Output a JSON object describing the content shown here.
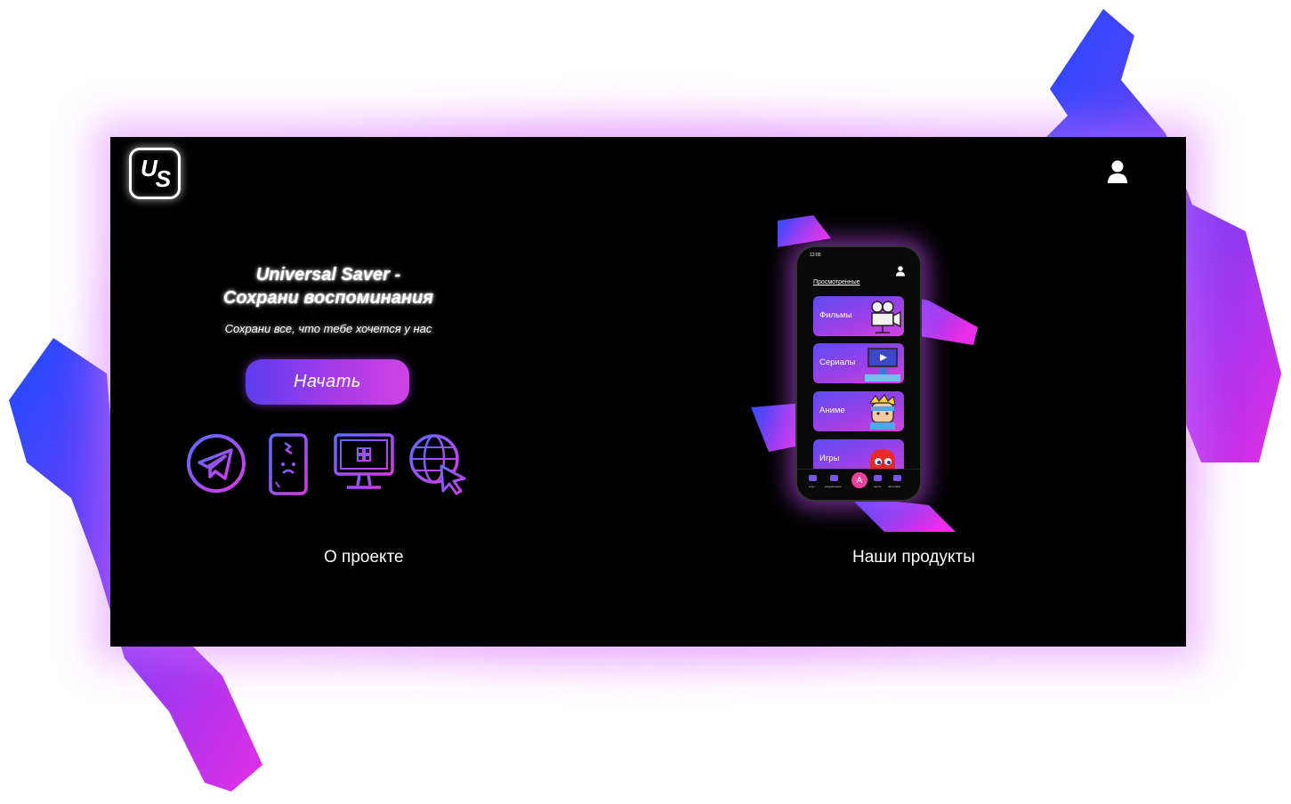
{
  "brand": {
    "logo_text_u": "U",
    "logo_text_s": "S"
  },
  "hero": {
    "title_line1": "Universal Saver -",
    "title_line2": "Сохрани воспоминания",
    "subtitle": "Сохрани все, что тебе хочется у нас",
    "cta_label": "Начать"
  },
  "features": [
    {
      "icon": "telegram-icon"
    },
    {
      "icon": "broken-phone-icon"
    },
    {
      "icon": "windows-monitor-icon"
    },
    {
      "icon": "globe-cursor-icon"
    }
  ],
  "nav": {
    "about_label": "О проекте",
    "products_label": "Наши продукты"
  },
  "phone": {
    "status_time": "12:00",
    "section_title": "Просмотренные",
    "categories": [
      {
        "label": "Фильмы",
        "icon": "movie-camera-icon"
      },
      {
        "label": "Сериалы",
        "icon": "tv-series-icon"
      },
      {
        "label": "Аниме",
        "icon": "anime-character-icon"
      },
      {
        "label": "Игры",
        "icon": "pacman-ghost-icon"
      }
    ],
    "tabs": [
      {
        "label": "игры",
        "icon": "games-tab-icon"
      },
      {
        "label": "уведомления",
        "icon": "notifications-tab-icon"
      },
      {
        "label": "А",
        "icon": "center-tab-icon"
      },
      {
        "label": "карты",
        "icon": "maps-tab-icon"
      },
      {
        "label": "настройки",
        "icon": "settings-tab-icon"
      }
    ]
  },
  "colors": {
    "accent_blue": "#2b4dff",
    "accent_purple": "#a73be8",
    "accent_pink": "#e233e6",
    "screen_bg": "#000000"
  }
}
